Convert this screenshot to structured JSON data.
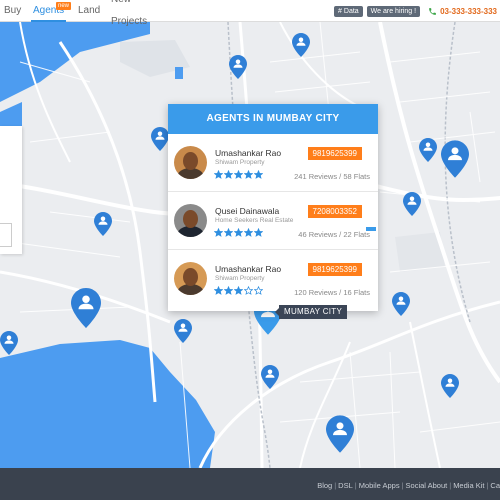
{
  "nav": {
    "items": [
      {
        "label": "Buy"
      },
      {
        "label": "Agents",
        "badge": "new",
        "active": true
      },
      {
        "label": "Land"
      },
      {
        "label": "New Projects"
      }
    ]
  },
  "toolbar": {
    "data_tag": "# Data",
    "hiring_tag": "We are hiring !",
    "phone": "03-333-333-333"
  },
  "agents_panel": {
    "title": "AGENTS IN MUMBAY CITY",
    "agents": [
      {
        "name": "Umashankar Rao",
        "company": "Shiwam Property",
        "phone": "9819625399",
        "rating": 5,
        "reviews": "241 Reviews / 58 Flats"
      },
      {
        "name": "Qusei Dainawala",
        "company": "Home Seekers Real Estate",
        "phone": "7208003352",
        "rating": 5,
        "reviews": "46 Reviews / 22 Flats"
      },
      {
        "name": "Umashankar Rao",
        "company": "Shiwam Property",
        "phone": "9819625399",
        "rating": 3,
        "reviews": "120 Reviews / 16 Flats"
      }
    ]
  },
  "map": {
    "city_label": "MUMBAY CITY"
  },
  "footer": {
    "links": [
      "Blog",
      "DSL",
      "Mobile Apps",
      "Social About",
      "Media Kit",
      "Ca"
    ]
  },
  "colors": {
    "accent": "#3a9bea",
    "orange": "#ff7e1a",
    "star": "#2f8fe0",
    "footer": "#3a424e"
  }
}
